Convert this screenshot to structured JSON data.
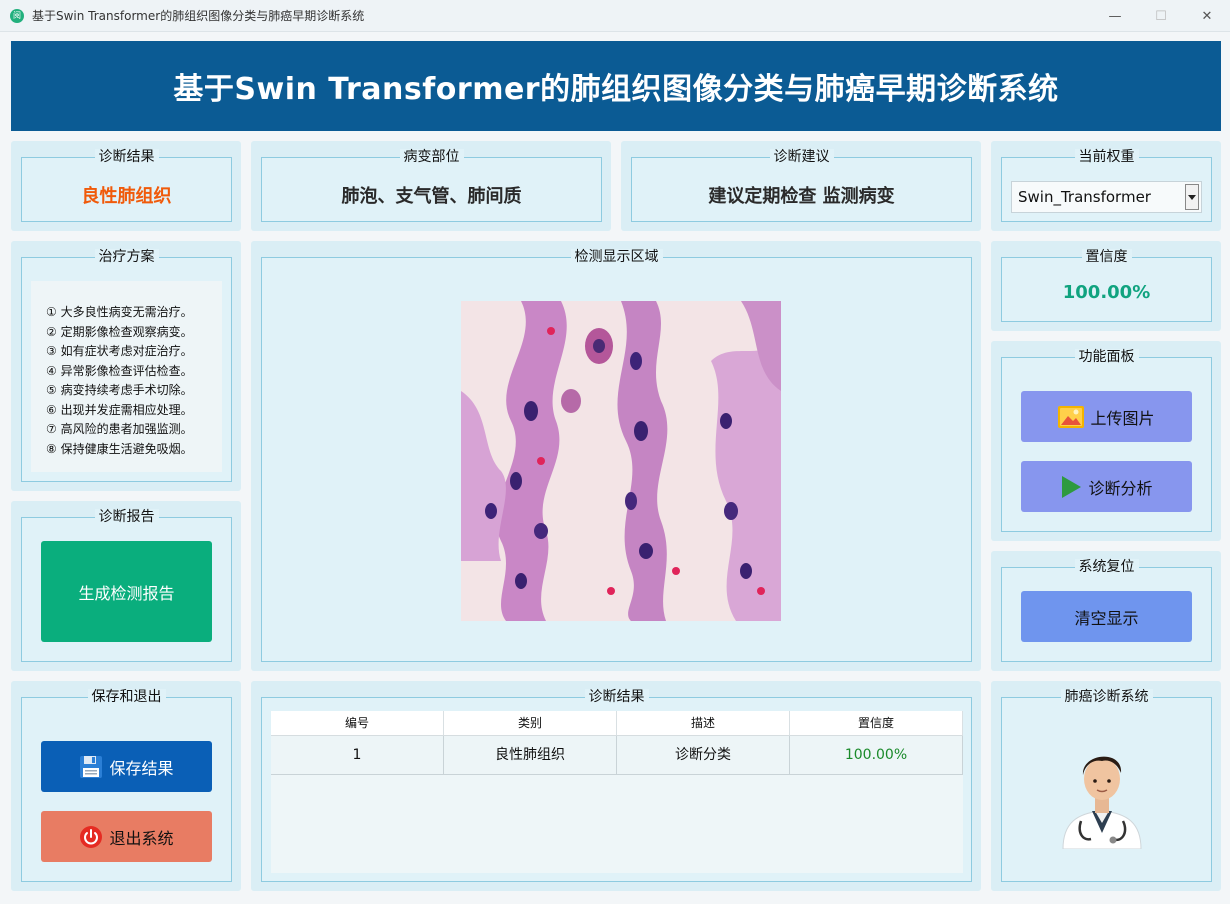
{
  "window": {
    "title": "基于Swin Transformer的肺组织图像分类与肺癌早期诊断系统",
    "app_icon_glyph": "阅",
    "controls": {
      "minimize": "—",
      "maximize": "☐",
      "close": "✕"
    }
  },
  "banner": {
    "title": "基于Swin Transformer的肺组织图像分类与肺癌早期诊断系统"
  },
  "result": {
    "title": "诊断结果",
    "value": "良性肺组织",
    "color": "#f05a0a"
  },
  "lesion": {
    "title": "病变部位",
    "value": "肺泡、支气管、肺间质"
  },
  "advice": {
    "title": "诊断建议",
    "value": "建议定期检查 监测病变"
  },
  "weight": {
    "title": "当前权重",
    "selected": "Swin_Transformer"
  },
  "treatment": {
    "title": "治疗方案",
    "items": [
      "① 大多良性病变无需治疗。",
      "② 定期影像检查观察病变。",
      "③ 如有症状考虑对症治疗。",
      "④ 异常影像检查评估检查。",
      "⑤ 病变持续考虑手术切除。",
      "⑥ 出现并发症需相应处理。",
      "⑦ 高风险的患者加强监测。",
      "⑧ 保持健康生活避免吸烟。"
    ]
  },
  "display": {
    "title": "检测显示区域",
    "image_icon": "histology-image"
  },
  "confidence": {
    "title": "置信度",
    "value": "100.00%",
    "color": "#10a37f"
  },
  "functions": {
    "title": "功能面板",
    "upload_label": "上传图片",
    "analyze_label": "诊断分析",
    "upload_icon": "image-icon",
    "analyze_icon": "play-icon"
  },
  "reset": {
    "title": "系统复位",
    "clear_label": "清空显示"
  },
  "report": {
    "title": "诊断报告",
    "generate_label": "生成检测报告"
  },
  "save_exit": {
    "title": "保存和退出",
    "save_label": "保存结果",
    "exit_label": "退出系统",
    "save_icon": "floppy-icon",
    "exit_icon": "power-icon"
  },
  "results_table": {
    "title": "诊断结果",
    "columns": [
      "编号",
      "类别",
      "描述",
      "置信度"
    ],
    "rows": [
      {
        "id": "1",
        "category": "良性肺组织",
        "desc": "诊断分类",
        "conf": "100.00%"
      }
    ],
    "conf_color": "#1a8a2a"
  },
  "system": {
    "title": "肺癌诊断系统",
    "avatar_icon": "doctor-avatar"
  },
  "colors": {
    "banner": "#0b5b94",
    "func_button": "#8796ee",
    "report_button": "#0aae7d",
    "save_button": "#0a5fb6",
    "exit_button": "#e87c63"
  }
}
